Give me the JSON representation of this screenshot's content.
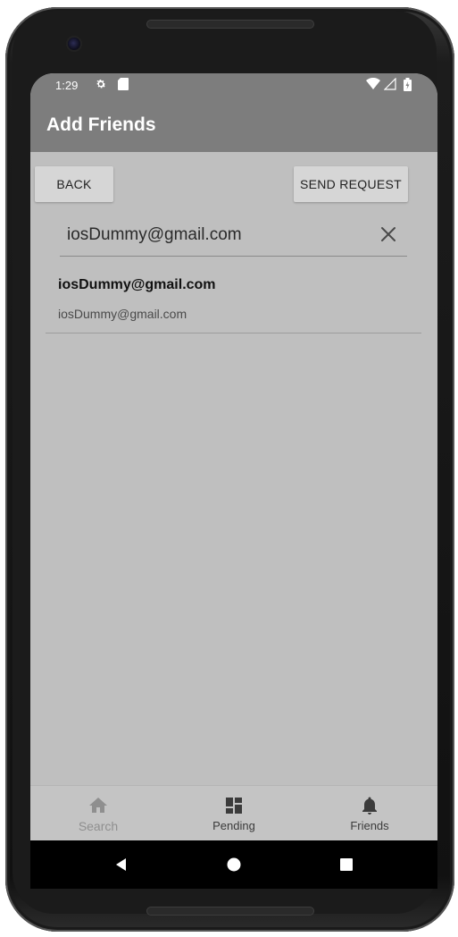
{
  "status_bar": {
    "time": "1:29",
    "icons": [
      "gear-icon",
      "sd-card-icon",
      "wifi-icon",
      "signal-icon",
      "battery-icon"
    ]
  },
  "app_bar": {
    "title": "Add Friends"
  },
  "actions": {
    "back_label": "BACK",
    "send_label": "SEND REQUEST"
  },
  "search": {
    "value": "iosDummy@gmail.com",
    "clear_icon": "close-icon"
  },
  "results": [
    {
      "primary": "iosDummy@gmail.com",
      "secondary": "iosDummy@gmail.com"
    }
  ],
  "bottom_nav": {
    "items": [
      {
        "label": "Search",
        "icon": "home-icon",
        "active": false
      },
      {
        "label": "Pending",
        "icon": "dashboard-icon",
        "active": true
      },
      {
        "label": "Friends",
        "icon": "bell-icon",
        "active": true
      }
    ]
  },
  "system_nav": [
    "back-triangle-icon",
    "home-circle-icon",
    "recents-square-icon"
  ],
  "colors": {
    "app_bar": "#7d7d7d",
    "background": "#bfbfbf",
    "button": "#d6d6d6"
  }
}
